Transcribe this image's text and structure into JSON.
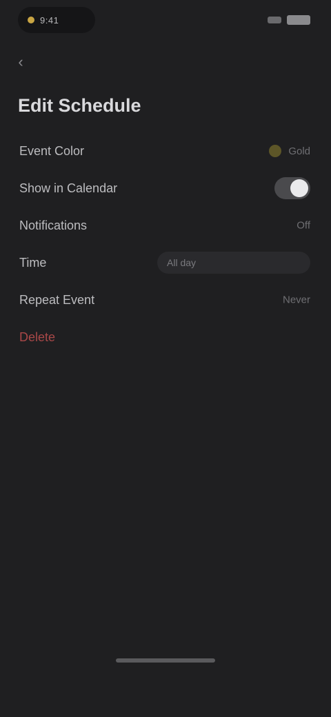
{
  "status_bar": {
    "time": "9:41"
  },
  "header": {
    "back_glyph": "‹",
    "title": "Edit Schedule"
  },
  "rows": [
    {
      "label": "Event Color",
      "value": "Gold"
    },
    {
      "label": "Show in Calendar",
      "value": "On"
    },
    {
      "label": "Notifications",
      "value": "Off"
    },
    {
      "label": "Time",
      "value": "All day"
    },
    {
      "label": "Repeat Event",
      "value": "Never"
    },
    {
      "label": "Delete"
    }
  ],
  "colors": {
    "background": "#1f1f21",
    "accent": "#c9a544",
    "danger": "#a94848"
  }
}
